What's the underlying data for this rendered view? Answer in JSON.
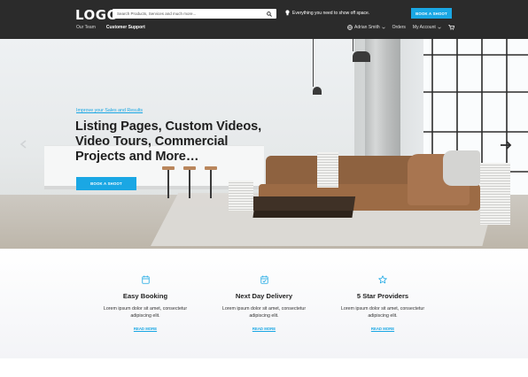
{
  "header": {
    "logo": "LOGO",
    "search_placeholder": "Search Products, Services and much more...",
    "promo_text": "Everything you need to show off space.",
    "cta_label": "BOOK A SHOOT",
    "nav_left": [
      {
        "label": "Our Team",
        "active": false
      },
      {
        "label": "Customer Support",
        "active": true
      }
    ],
    "user_name": "Adrian Smith",
    "orders_label": "Orders",
    "account_label": "My Account"
  },
  "hero": {
    "eyebrow": "Improve your Sales and Results",
    "headline": "Listing Pages, Custom Videos, Video Tours, Commercial Projects and More…",
    "cta_label": "BOOK A SHOOT"
  },
  "features": [
    {
      "icon": "calendar-icon",
      "title": "Easy Booking",
      "desc_line1": "Lorem ipsum dolor sit amet, consectetur",
      "desc_line2": "adipiscing elit.",
      "link": "READ MORE"
    },
    {
      "icon": "calendar-check-icon",
      "title": "Next Day Delivery",
      "desc_line1": "Lorem ipsum dolor sit amet, consectetur",
      "desc_line2": "adipiscing elit.",
      "link": "READ MORE"
    },
    {
      "icon": "star-icon",
      "title": "5 Star Providers",
      "desc_line1": "Lorem ipsum dolor sit amet, consectetur",
      "desc_line2": "adipiscing elit.",
      "link": "READ MORE"
    }
  ],
  "colors": {
    "accent": "#1aa7e4",
    "header_bg": "#2b2b2b"
  }
}
